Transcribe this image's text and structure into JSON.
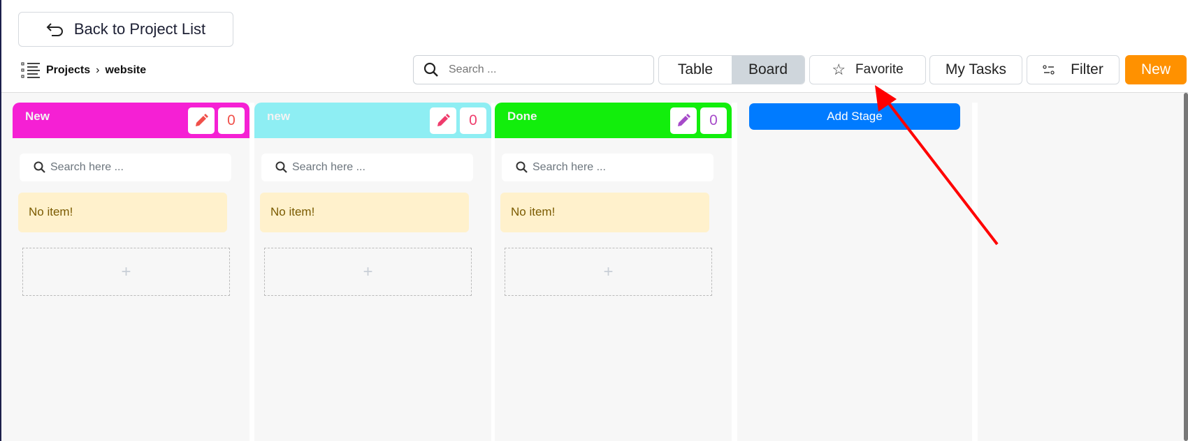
{
  "back_label": "Back to Project List",
  "breadcrumb": {
    "root": "Projects",
    "current": "website"
  },
  "search": {
    "placeholder": "Search ..."
  },
  "view_toggle": {
    "table": "Table",
    "board": "Board",
    "active": "Board"
  },
  "favorite_label": "Favorite",
  "my_tasks_label": "My Tasks",
  "filter_label": "Filter",
  "new_label": "New",
  "columns": [
    {
      "title": "New",
      "count": "0",
      "color": "#f520d4",
      "icon_color": "#f0504a",
      "search_placeholder": "Search here ...",
      "empty_text": "No item!",
      "add_label": "+"
    },
    {
      "title": "new",
      "count": "0",
      "color": "#8eeef3",
      "icon_color": "#ef3c6c",
      "search_placeholder": "Search here ...",
      "empty_text": "No item!",
      "add_label": "+"
    },
    {
      "title": "Done",
      "count": "0",
      "color": "#12ee0c",
      "icon_color": "#a64ac9",
      "search_placeholder": "Search here ...",
      "empty_text": "No item!",
      "add_label": "+"
    }
  ],
  "add_stage_label": "Add Stage"
}
